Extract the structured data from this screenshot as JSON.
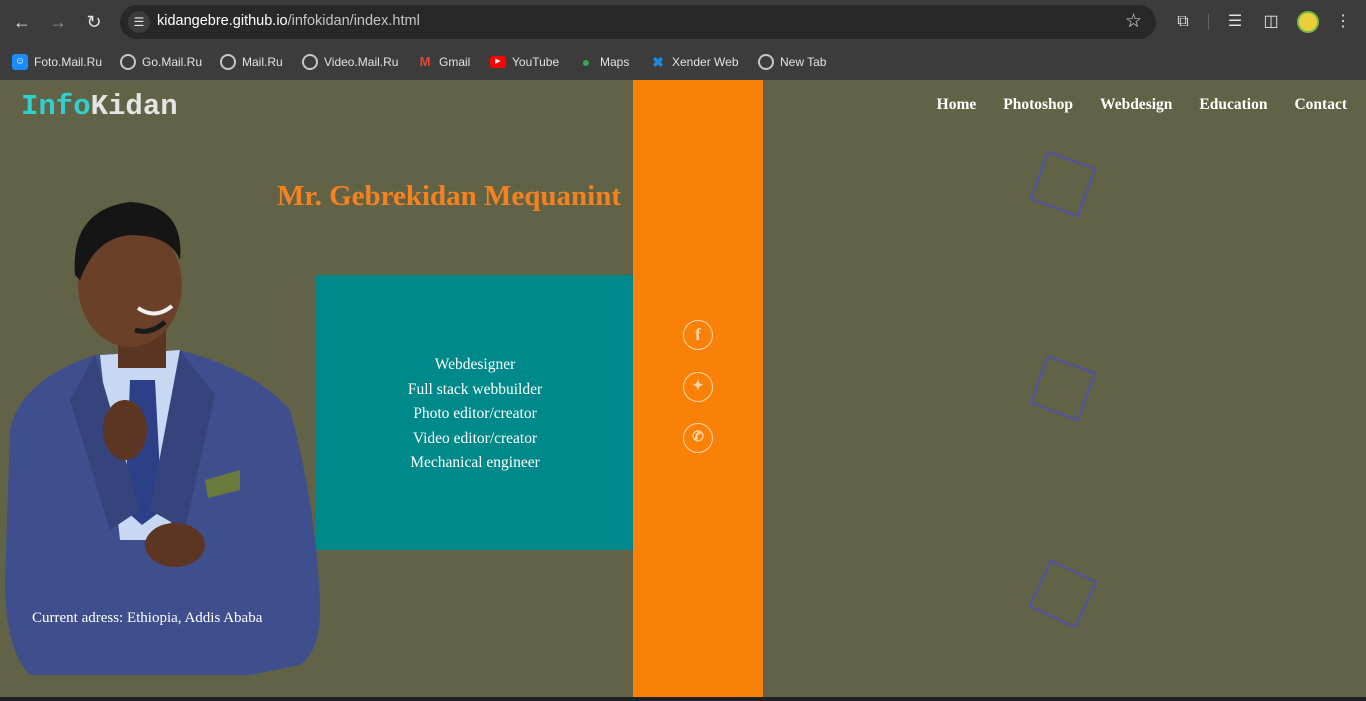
{
  "browser": {
    "url_host": "kidangebre.github.io",
    "url_path": "/infokidan/index.html",
    "bookmarks": [
      {
        "label": "Foto.Mail.Ru",
        "icon": "foto-mail-icon"
      },
      {
        "label": "Go.Mail.Ru",
        "icon": "globe-icon"
      },
      {
        "label": "Mail.Ru",
        "icon": "globe-icon"
      },
      {
        "label": "Video.Mail.Ru",
        "icon": "globe-icon"
      },
      {
        "label": "Gmail",
        "icon": "gmail-icon"
      },
      {
        "label": "YouTube",
        "icon": "youtube-icon"
      },
      {
        "label": "Maps",
        "icon": "maps-icon"
      },
      {
        "label": "Xender Web",
        "icon": "xender-icon"
      },
      {
        "label": "New Tab",
        "icon": "globe-icon"
      }
    ]
  },
  "site": {
    "logo_part1": "Info",
    "logo_part2": "Kidan",
    "nav": [
      "Home",
      "Photoshop",
      "Webdesign",
      "Education",
      "Contact"
    ],
    "name": "Mr. Gebrekidan Mequanint",
    "roles": [
      "Webdesigner",
      "Full stack webbuilder",
      "Photo editor/creator",
      "Video editor/creator",
      "Mechanical engineer"
    ],
    "address": "Current adress: Ethiopia, Addis Ababa",
    "social_icons": [
      "facebook-icon",
      "twitter-icon",
      "whatsapp-icon"
    ]
  },
  "colors": {
    "page_bg": "#626346",
    "accent_orange": "#f98108",
    "teal": "#00898a",
    "logo_cyan": "#2fd0d0",
    "name_orange": "#f5821f",
    "deco_square": "#5151a8"
  }
}
